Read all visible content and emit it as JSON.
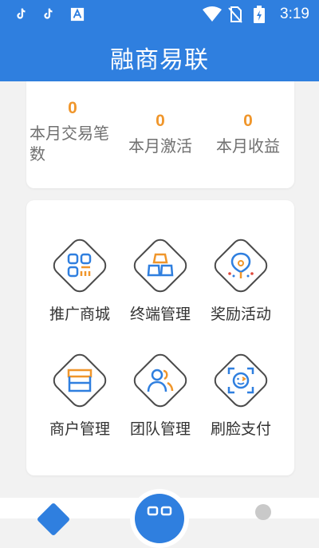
{
  "status_bar": {
    "time": "3:19",
    "icons": [
      "tiktok-icon",
      "tiktok-icon",
      "font-a-icon",
      "wifi-icon",
      "no-sim-icon",
      "battery-charging-icon"
    ]
  },
  "app_bar": {
    "title": "融商易联"
  },
  "stats": [
    {
      "value": "0",
      "label": "本月交易笔数"
    },
    {
      "value": "0",
      "label": "本月激活"
    },
    {
      "value": "0",
      "label": "本月收益"
    }
  ],
  "menu": [
    {
      "label": "推广商城",
      "icon": "qr-grid-icon"
    },
    {
      "label": "终端管理",
      "icon": "terminal-blocks-icon"
    },
    {
      "label": "奖励活动",
      "icon": "balloon-icon"
    },
    {
      "label": "商户管理",
      "icon": "storefront-icon"
    },
    {
      "label": "团队管理",
      "icon": "team-users-icon"
    },
    {
      "label": "刷脸支付",
      "icon": "face-scan-icon"
    }
  ],
  "colors": {
    "primary": "#2f7fdf",
    "accent_orange": "#f0962b",
    "text_gray": "#707070"
  }
}
